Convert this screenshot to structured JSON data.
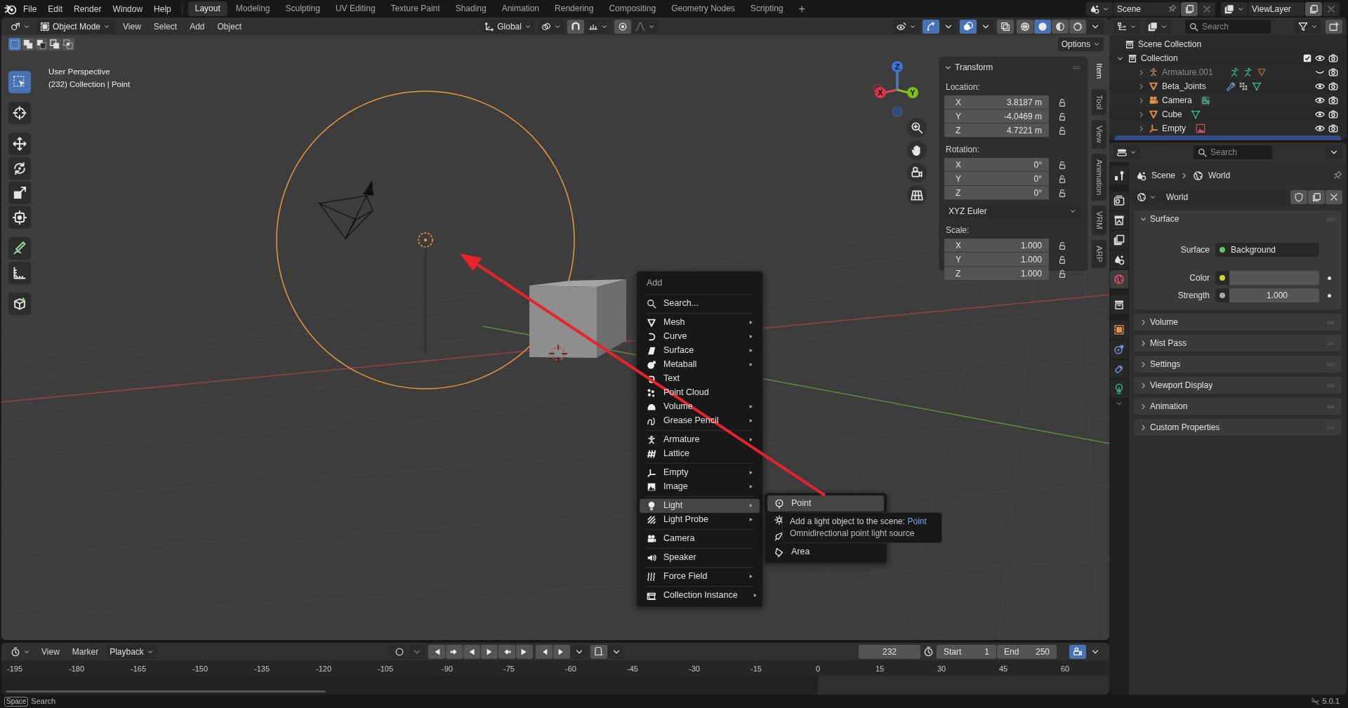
{
  "topbar": {
    "menus": [
      "File",
      "Edit",
      "Render",
      "Window",
      "Help"
    ],
    "workspaces": [
      {
        "label": "Layout",
        "selected": true
      },
      {
        "label": "Modeling",
        "selected": false
      },
      {
        "label": "Sculpting",
        "selected": false
      },
      {
        "label": "UV Editing",
        "selected": false
      },
      {
        "label": "Texture Paint",
        "selected": false
      },
      {
        "label": "Shading",
        "selected": false
      },
      {
        "label": "Animation",
        "selected": false
      },
      {
        "label": "Rendering",
        "selected": false
      },
      {
        "label": "Compositing",
        "selected": false
      },
      {
        "label": "Geometry Nodes",
        "selected": false
      },
      {
        "label": "Scripting",
        "selected": false
      }
    ],
    "add_workspace": "+",
    "scene": "Scene",
    "view_layer": "ViewLayer"
  },
  "viewport": {
    "header": {
      "mode": "Object Mode",
      "menus": [
        "View",
        "Select",
        "Add",
        "Object"
      ],
      "orientation": "Global",
      "options": "Options",
      "gizmos_on": true,
      "overlays_on": true
    },
    "shading_modes": [
      {
        "selected": false
      },
      {
        "selected": true
      },
      {
        "selected": false
      },
      {
        "selected": false
      }
    ],
    "select_modes": [
      {
        "selected": true
      },
      {
        "selected": false
      },
      {
        "selected": false
      },
      {
        "selected": false
      },
      {
        "selected": false
      }
    ],
    "tools": [
      {
        "selected": true
      },
      {
        "selected": false
      },
      {
        "selected": false
      },
      {
        "selected": false
      },
      {
        "selected": false
      },
      {
        "selected": false
      },
      {
        "selected": false
      },
      {
        "selected": false
      },
      {
        "selected": false
      }
    ],
    "overlay_text": [
      "User Perspective",
      "(232) Collection | Point"
    ],
    "gizmo": {
      "x": "X",
      "y": "Y",
      "z": "Z"
    },
    "sidebar": {
      "title": "Transform",
      "location_label": "Location:",
      "location": [
        {
          "axis": "X",
          "value": "3.8187 m"
        },
        {
          "axis": "Y",
          "value": "-4.0469 m"
        },
        {
          "axis": "Z",
          "value": "4.7221 m"
        }
      ],
      "rotation_label": "Rotation:",
      "rotation": [
        {
          "axis": "X",
          "value": "0°"
        },
        {
          "axis": "Y",
          "value": "0°"
        },
        {
          "axis": "Z",
          "value": "0°"
        }
      ],
      "rotation_mode": "XYZ Euler",
      "scale_label": "Scale:",
      "scale": [
        {
          "axis": "X",
          "value": "1.000"
        },
        {
          "axis": "Y",
          "value": "1.000"
        },
        {
          "axis": "Z",
          "value": "1.000"
        }
      ],
      "tabs": [
        {
          "label": "Item",
          "selected": true
        },
        {
          "label": "Tool",
          "selected": false
        },
        {
          "label": "View",
          "selected": false
        },
        {
          "label": "Animation",
          "selected": false
        },
        {
          "label": "VRM",
          "selected": false
        },
        {
          "label": "ARP",
          "selected": false
        }
      ]
    },
    "add_menu": {
      "title": "Add",
      "search": "Search...",
      "groups": [
        [
          {
            "label": "Mesh",
            "submenu": true,
            "selected": false
          },
          {
            "label": "Curve",
            "submenu": true,
            "selected": false
          },
          {
            "label": "Surface",
            "submenu": true,
            "selected": false
          },
          {
            "label": "Metaball",
            "submenu": true,
            "selected": false
          },
          {
            "label": "Text",
            "submenu": false,
            "selected": false
          },
          {
            "label": "Point Cloud",
            "submenu": false,
            "selected": false
          },
          {
            "label": "Volume",
            "submenu": true,
            "selected": false
          },
          {
            "label": "Grease Pencil",
            "submenu": true,
            "selected": false
          }
        ],
        [
          {
            "label": "Armature",
            "submenu": true,
            "selected": false
          },
          {
            "label": "Lattice",
            "submenu": false,
            "selected": false
          }
        ],
        [
          {
            "label": "Empty",
            "submenu": true,
            "selected": false
          },
          {
            "label": "Image",
            "submenu": true,
            "selected": false
          }
        ],
        [
          {
            "label": "Light",
            "submenu": true,
            "selected": true
          },
          {
            "label": "Light Probe",
            "submenu": true,
            "selected": false
          }
        ],
        [
          {
            "label": "Camera",
            "submenu": false,
            "selected": false
          }
        ],
        [
          {
            "label": "Speaker",
            "submenu": false,
            "selected": false
          }
        ],
        [
          {
            "label": "Force Field",
            "submenu": true,
            "selected": false
          }
        ],
        [
          {
            "label": "Collection Instance",
            "submenu": true,
            "selected": false
          }
        ]
      ]
    },
    "light_submenu": [
      {
        "label": "Point",
        "selected": true
      },
      {
        "selected": false
      },
      {
        "selected": false
      },
      {
        "label": "Area",
        "selected": false
      }
    ],
    "tooltip": {
      "text": "Add a light object to the scene:",
      "value": "Point",
      "description": "Omnidirectional point light source"
    }
  },
  "timeline": {
    "menus": [
      "View",
      "Marker",
      "Playback"
    ],
    "frame": "232",
    "start_label": "Start",
    "start": "1",
    "end_label": "End",
    "end": "250",
    "ticks": [
      "-195",
      "-180",
      "-165",
      "-150",
      "-135",
      "-120",
      "-105",
      "-90",
      "-75",
      "-60",
      "-45",
      "-30",
      "-15",
      "0",
      "15",
      "30",
      "45",
      "60"
    ]
  },
  "outliner": {
    "search_placeholder": "Search",
    "root": "Scene Collection",
    "collection": {
      "name": "Collection",
      "checked": true,
      "expanded": true,
      "children": [
        {
          "name": "Armature.001",
          "kind": "armature",
          "visible": false
        },
        {
          "name": "Beta_Joints",
          "kind": "mesh",
          "visible": true
        },
        {
          "name": "Camera",
          "kind": "camera",
          "visible": true
        },
        {
          "name": "Cube",
          "kind": "mesh",
          "visible": true
        },
        {
          "name": "Empty",
          "kind": "empty",
          "visible": true
        }
      ]
    }
  },
  "properties": {
    "search_placeholder": "Search",
    "tabs": [
      {
        "selected": false
      },
      {
        "selected": false
      },
      {
        "selected": false
      },
      {
        "selected": false
      },
      {
        "selected": false
      },
      {
        "selected": true
      },
      {
        "selected": false
      },
      {
        "selected": false
      },
      {
        "selected": false
      },
      {
        "selected": false
      },
      {
        "selected": false
      }
    ],
    "breadcrumb": [
      "Scene",
      "World"
    ],
    "world": "World",
    "panels": [
      {
        "title": "Surface",
        "expanded": true,
        "fields": [
          {
            "label": "Surface",
            "value": "Background",
            "color": "#5ec45e"
          },
          {
            "label": "Color",
            "color": "#d6cf2c"
          },
          {
            "label": "Strength",
            "value": "1.000",
            "color": "#a8a8a8"
          }
        ]
      },
      {
        "title": "Volume",
        "expanded": false
      },
      {
        "title": "Mist Pass",
        "expanded": false
      },
      {
        "title": "Settings",
        "expanded": false
      },
      {
        "title": "Viewport Display",
        "expanded": false
      },
      {
        "title": "Animation",
        "expanded": false
      },
      {
        "title": "Custom Properties",
        "expanded": false
      }
    ]
  },
  "status_bar": {
    "key": "Space",
    "action": "Search",
    "version": "5.0.1"
  }
}
